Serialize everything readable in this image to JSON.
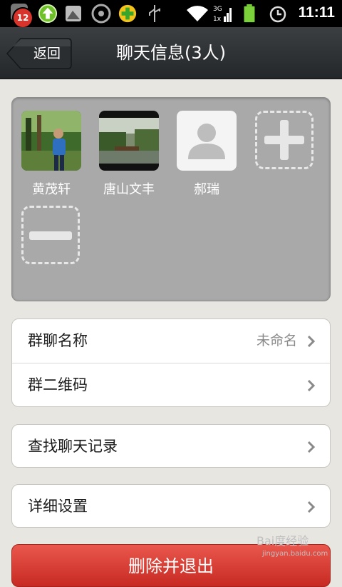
{
  "status_bar": {
    "notification_count": "12",
    "time": "11:11",
    "icons": [
      "upload-arrow-icon",
      "image-icon",
      "disc-icon",
      "plus-app-icon",
      "usb-icon",
      "wifi-icon",
      "signal-3g-icon",
      "battery-icon",
      "alarm-icon"
    ]
  },
  "header": {
    "back_label": "返回",
    "title": "聊天信息(3人)"
  },
  "members": [
    {
      "name": "黄茂轩"
    },
    {
      "name": "唐山文丰"
    },
    {
      "name": "郝瑞"
    }
  ],
  "settings": {
    "group_name_label": "群聊名称",
    "group_name_value": "未命名",
    "qr_label": "群二维码",
    "search_label": "查找聊天记录",
    "detail_label": "详细设置"
  },
  "danger_button_label": "删除并退出",
  "watermark": {
    "text": "Bai度经验",
    "sub": "jingyan.baidu.com"
  },
  "colors": {
    "title_bar": "#2e3134",
    "panel": "#a9a9a9",
    "danger": "#d9362c"
  }
}
